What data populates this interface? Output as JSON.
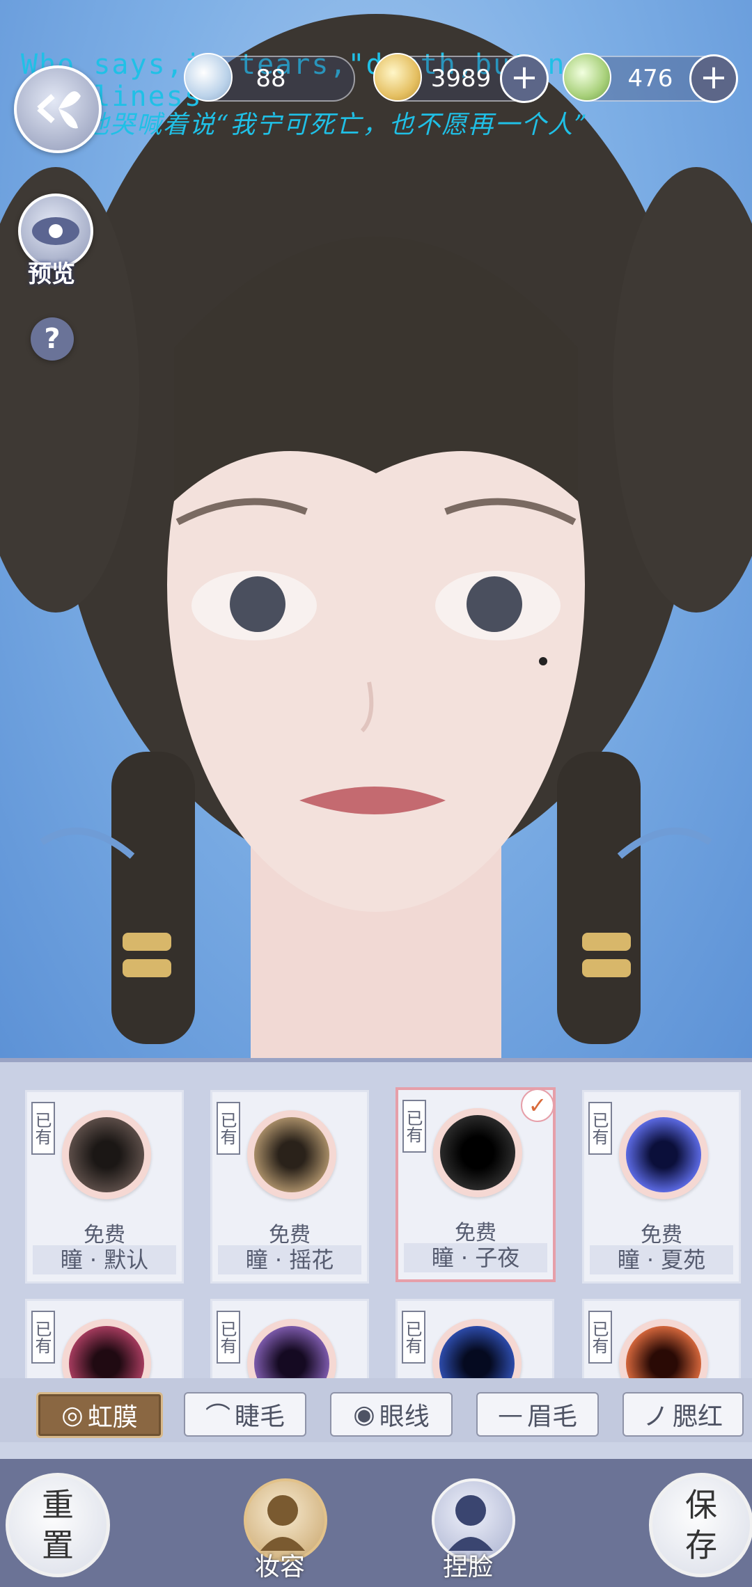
{
  "overlay": {
    "line_en": "Who  says,in  tears,\"death,but  not  loneliness\"",
    "line_cn": "他哭喊着说“我宁可死亡，也不愿再一个人”"
  },
  "currencies": [
    {
      "value": "88",
      "icon": "jade-coin-icon"
    },
    {
      "value": "3989",
      "icon": "gold-coin-icon"
    },
    {
      "value": "476",
      "icon": "green-coin-icon"
    }
  ],
  "side": {
    "preview_label": "预览",
    "help_label": "?"
  },
  "irises": [
    {
      "owned": "已有",
      "price": "免费",
      "name": "瞳 · 默认",
      "color": "#3a2f2c",
      "selected": false
    },
    {
      "owned": "已有",
      "price": "免费",
      "name": "瞳 · 摇花",
      "color": "#7a654a",
      "selected": false
    },
    {
      "owned": "已有",
      "price": "免费",
      "name": "瞳 · 子夜",
      "color": "#111111",
      "selected": true
    },
    {
      "owned": "已有",
      "price": "免费",
      "name": "瞳 · 夏苑",
      "color": "#3a47b8",
      "selected": false
    },
    {
      "owned": "已有",
      "color": "#6a1f35"
    },
    {
      "owned": "已有",
      "color": "#4a2a6a"
    },
    {
      "owned": "已有",
      "color": "#152a66"
    },
    {
      "owned": "已有",
      "color": "#9a3a2a"
    }
  ],
  "tabs": [
    {
      "label": "虹膜",
      "icon": "iris-icon",
      "active": true
    },
    {
      "label": "睫毛",
      "icon": "eyelash-icon",
      "active": false
    },
    {
      "label": "眼线",
      "icon": "eyeliner-icon",
      "active": false
    },
    {
      "label": "眉毛",
      "icon": "eyebrow-icon",
      "active": false
    },
    {
      "label": "腮红",
      "icon": "blush-icon",
      "active": false
    }
  ],
  "bottom": {
    "reset_label": "重置",
    "makeup_label": "妆容",
    "face_label": "捏脸",
    "save_label": "保存"
  }
}
